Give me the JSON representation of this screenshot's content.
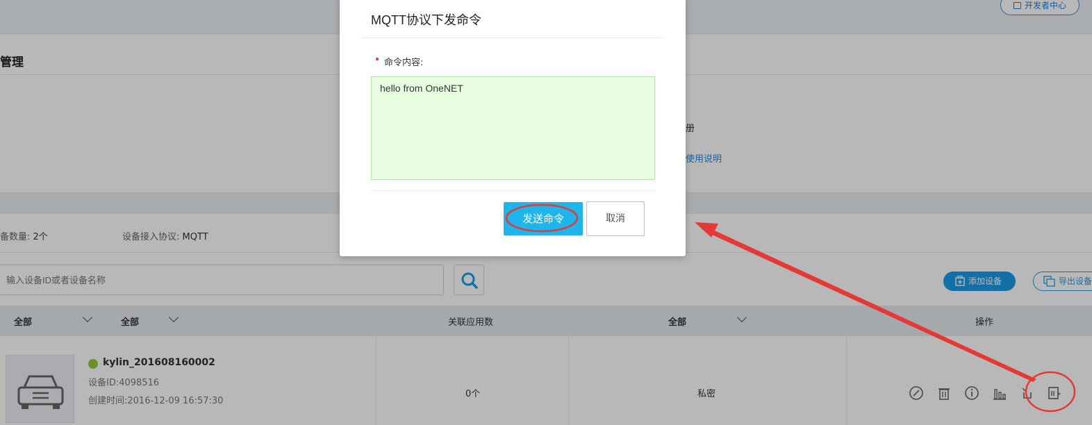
{
  "header": {
    "dev_center_label": "开发者中心"
  },
  "page": {
    "title": "管理"
  },
  "info": {
    "line1": "册",
    "line2": "使用说明"
  },
  "stats": {
    "device_count_label": "备数量:",
    "device_count_value": "2个",
    "protocol_label": "设备接入协议:",
    "protocol_value": "MQTT"
  },
  "search": {
    "placeholder": "输入设备ID或者设备名称"
  },
  "actions": {
    "add_device": "添加设备",
    "export_device": "导出设备"
  },
  "table": {
    "headers": [
      "全部",
      "全部",
      "关联应用数",
      "全部",
      "操作"
    ],
    "rows": [
      {
        "name": "kylin_201608160002",
        "id": "设备ID:4098516",
        "created": "创建时间:2016-12-09 16:57:30",
        "apps": "0个",
        "privacy": "私密",
        "status_color": "#93c93d"
      }
    ]
  },
  "modal": {
    "title": "MQTT协议下发命令",
    "field_label": "命令内容:",
    "command_value": "hello from OneNET",
    "send_label": "发送命令",
    "cancel_label": "取消"
  },
  "colors": {
    "accent": "#1db5ec",
    "annotation": "#e53935",
    "textarea_bg": "#eaffe2"
  }
}
